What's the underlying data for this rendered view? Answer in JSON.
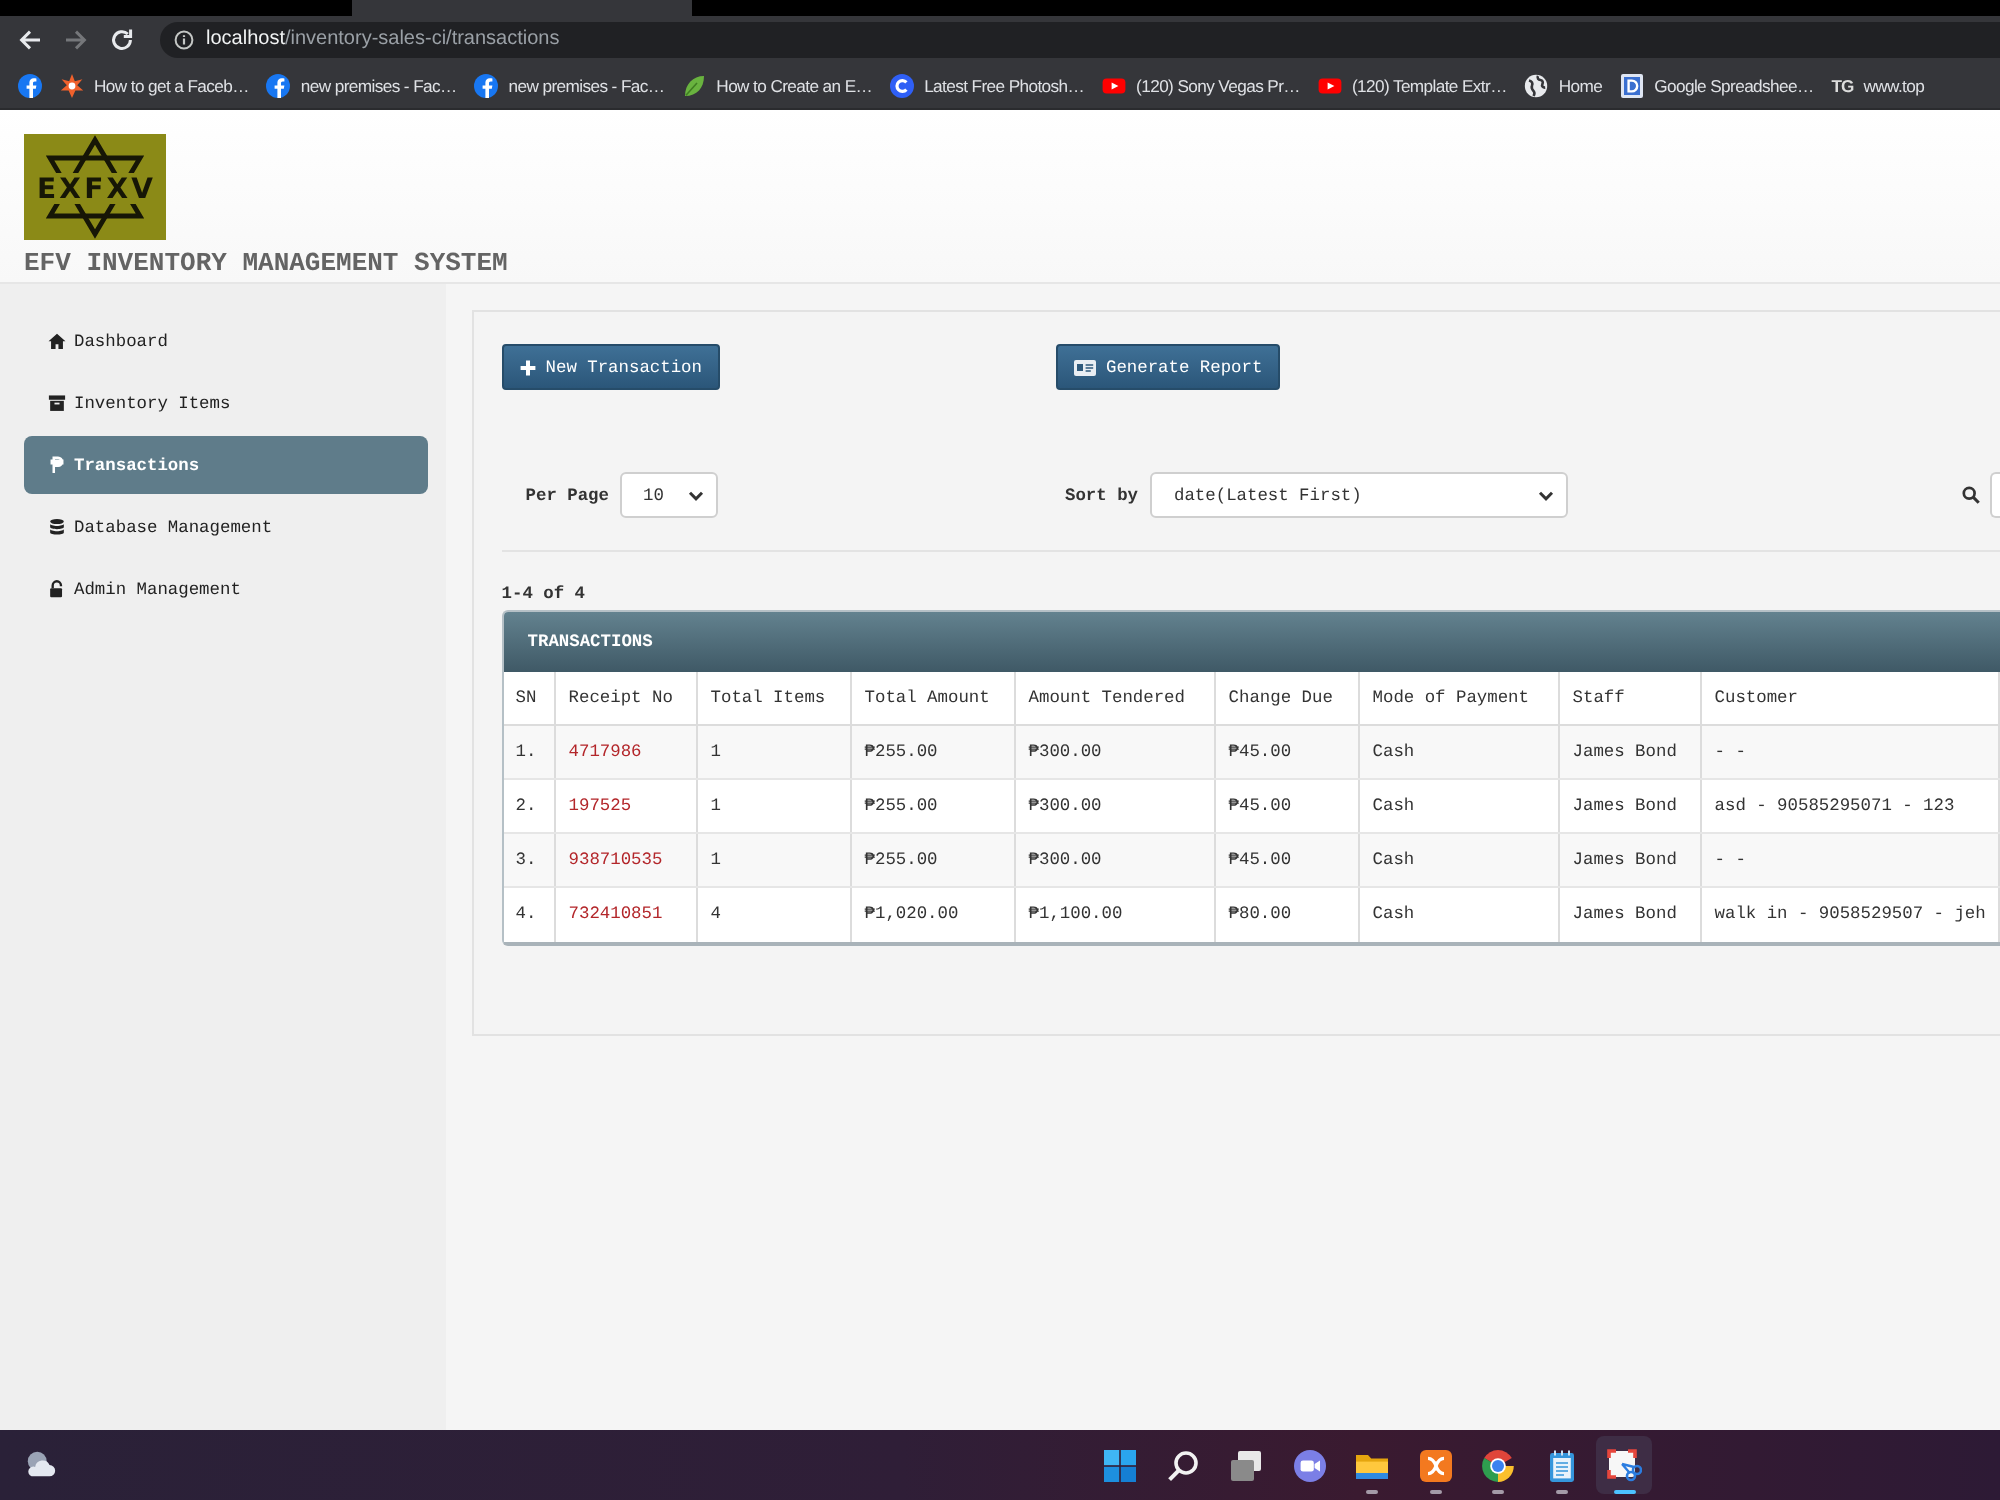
{
  "browser": {
    "nav": [
      {
        "kind": "back",
        "disabled": false
      },
      {
        "kind": "forward",
        "disabled": true
      },
      {
        "kind": "reload",
        "disabled": false
      }
    ],
    "url": {
      "host": "localhost",
      "path": "/inventory-sales-ci/transactions"
    }
  },
  "bookmarks": [
    {
      "kind": "facebook"
    },
    {
      "kind": "burst",
      "label": "How to get a Faceb…"
    },
    {
      "kind": "facebook",
      "label": "new premises - Fac…"
    },
    {
      "kind": "facebook",
      "label": "new premises - Fac…"
    },
    {
      "kind": "leaf",
      "label": "How to Create an E…"
    },
    {
      "kind": "c-badge",
      "label": "Latest Free Photosh…"
    },
    {
      "kind": "video",
      "label": "(120) Sony Vegas Pr…"
    },
    {
      "kind": "video",
      "label": "(120) Template Extr…"
    },
    {
      "kind": "globe",
      "label": "Home"
    },
    {
      "kind": "sheet",
      "label": "Google Spreadshee…"
    },
    {
      "kind": "letters",
      "icon_text": "TG",
      "label": "www.top"
    }
  ],
  "header": {
    "logo_text": "EXFXV",
    "title": "EFV INVENTORY MANAGEMENT SYSTEM"
  },
  "sidebar": {
    "items": [
      {
        "label": "Dashboard",
        "selected": false
      },
      {
        "label": "Inventory Items",
        "selected": false
      },
      {
        "label": "Transactions",
        "selected": true
      },
      {
        "label": "Database Management",
        "selected": false
      },
      {
        "label": "Admin Management",
        "selected": false
      }
    ]
  },
  "actions": [
    {
      "label": "New Transaction"
    },
    {
      "label": "Generate Report"
    }
  ],
  "filters": {
    "per_page": {
      "label": "Per Page",
      "value": "10"
    },
    "sort": {
      "label": "Sort by",
      "value": "date(Latest First)"
    }
  },
  "range": "1-4 of 4",
  "table": {
    "title": "TRANSACTIONS",
    "columns": [
      {
        "label": "SN",
        "kind": "text"
      },
      {
        "label": "Receipt No",
        "kind": "link"
      },
      {
        "label": "Total Items",
        "kind": "text"
      },
      {
        "label": "Total Amount",
        "kind": "text"
      },
      {
        "label": "Amount Tendered",
        "kind": "text"
      },
      {
        "label": "Change Due",
        "kind": "text"
      },
      {
        "label": "Mode of Payment",
        "kind": "text"
      },
      {
        "label": "Staff",
        "kind": "text"
      },
      {
        "label": "Customer",
        "kind": "text"
      }
    ],
    "rows": [
      [
        "1.",
        "4717986",
        "1",
        "₱255.00",
        "₱300.00",
        "₱45.00",
        "Cash",
        "James Bond",
        "- -"
      ],
      [
        "2.",
        "197525",
        "1",
        "₱255.00",
        "₱300.00",
        "₱45.00",
        "Cash",
        "James Bond",
        "asd - 90585295071 - 123"
      ],
      [
        "3.",
        "938710535",
        "1",
        "₱255.00",
        "₱300.00",
        "₱45.00",
        "Cash",
        "James Bond",
        "- -"
      ],
      [
        "4.",
        "732410851",
        "4",
        "₱1,020.00",
        "₱1,100.00",
        "₱80.00",
        "Cash",
        "James Bond",
        "walk in - 9058529507 - jeh"
      ]
    ]
  },
  "taskbar": {
    "apps": [
      {
        "kind": "start",
        "running": false,
        "selected": false
      },
      {
        "kind": "search",
        "running": false,
        "selected": false
      },
      {
        "kind": "windows",
        "running": false,
        "selected": false
      },
      {
        "kind": "chat",
        "running": false,
        "selected": false
      },
      {
        "kind": "folder",
        "running": true,
        "selected": false
      },
      {
        "kind": "x-app",
        "running": true,
        "selected": false
      },
      {
        "kind": "web-browser",
        "running": true,
        "selected": false
      },
      {
        "kind": "notepad",
        "running": true,
        "selected": false
      },
      {
        "kind": "snip",
        "running": true,
        "selected": true
      }
    ]
  }
}
